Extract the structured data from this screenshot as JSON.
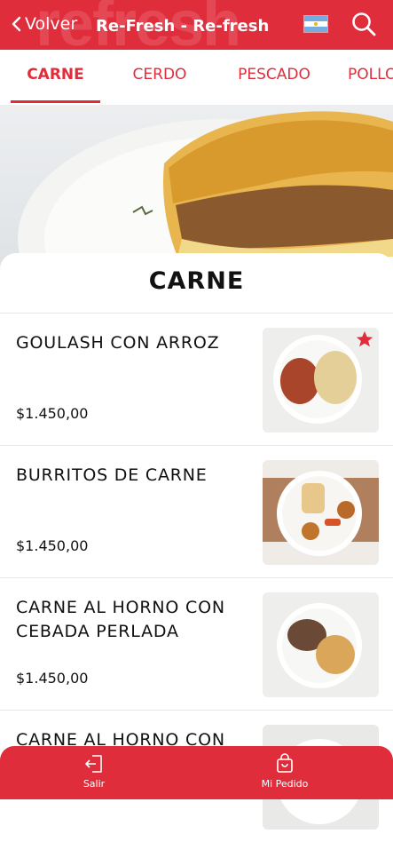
{
  "header": {
    "back_label": "Volver",
    "title": "Re-Fresh - Re-fresh",
    "watermark": "refresh"
  },
  "tabs": [
    {
      "label": "CARNE",
      "active": true
    },
    {
      "label": "CERDO",
      "active": false
    },
    {
      "label": "PESCADO",
      "active": false
    },
    {
      "label": "POLLO",
      "active": false
    }
  ],
  "section": {
    "title": "CARNE"
  },
  "items": [
    {
      "name": "GOULASH CON ARROZ",
      "price": "$1.450,00",
      "favorite": true
    },
    {
      "name": "BURRITOS DE CARNE",
      "price": "$1.450,00",
      "favorite": false
    },
    {
      "name": "CARNE AL HORNO CON CEBADA PERLADA",
      "price": "$1.450,00",
      "favorite": false
    },
    {
      "name": "CARNE AL HORNO CON",
      "price": "",
      "favorite": false
    }
  ],
  "bottom_bar": {
    "exit_label": "Salir",
    "order_label": "Mi Pedido"
  },
  "colors": {
    "brand": "#e02d3c",
    "favorite": "#e02d3c"
  }
}
